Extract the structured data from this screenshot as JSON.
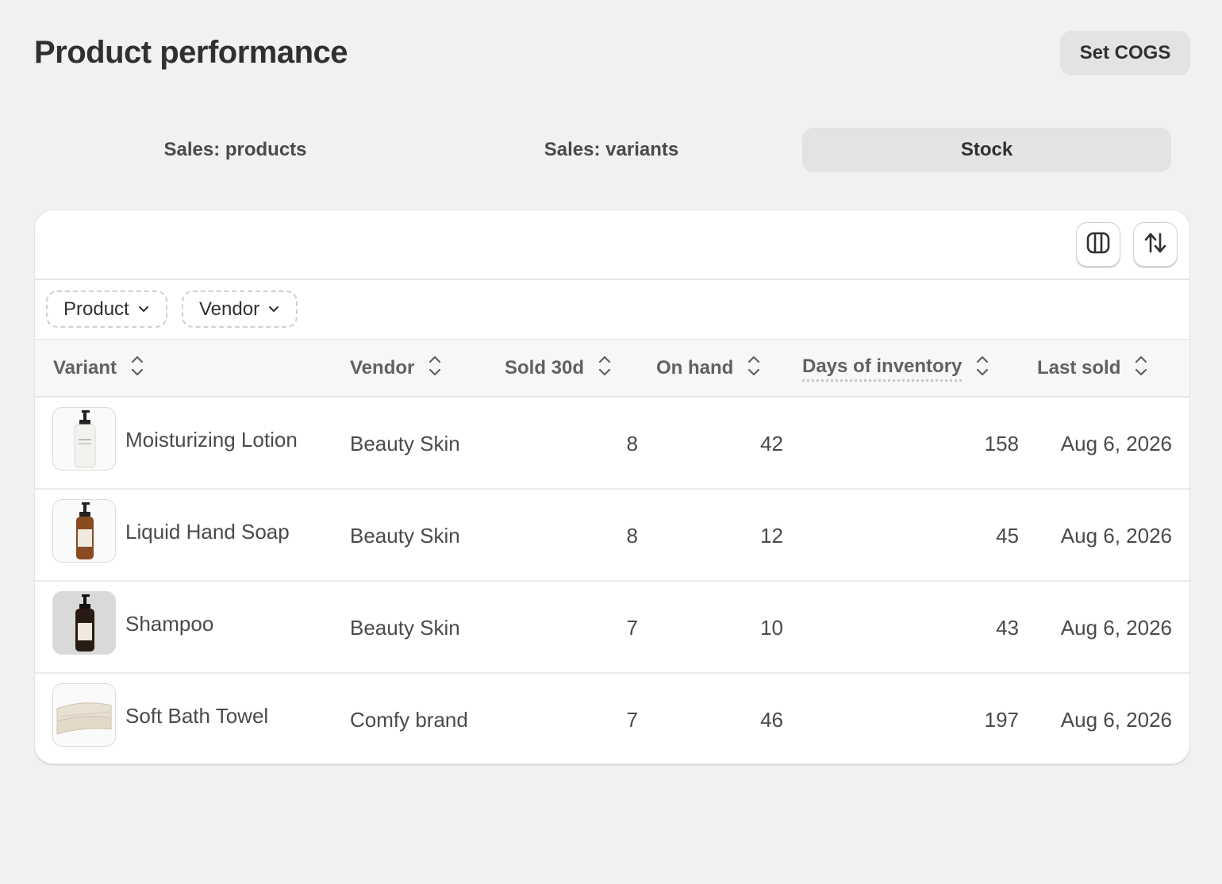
{
  "header": {
    "title": "Product performance",
    "set_cogs_label": "Set COGS"
  },
  "tabs": [
    {
      "label": "Sales: products",
      "active": false
    },
    {
      "label": "Sales: variants",
      "active": false
    },
    {
      "label": "Stock",
      "active": true
    }
  ],
  "toolbar": {
    "icons": [
      "columns-icon",
      "sort-icon"
    ]
  },
  "filters": [
    {
      "label": "Product"
    },
    {
      "label": "Vendor"
    }
  ],
  "columns": [
    "Variant",
    "Vendor",
    "Sold 30d",
    "On hand",
    "Days of inventory",
    "Last sold"
  ],
  "rows": [
    {
      "variant": "Moisturizing Lotion",
      "vendor": "Beauty Skin",
      "sold_30d": "8",
      "on_hand": "42",
      "days_of_inventory": "158",
      "last_sold": "Aug 6, 2026",
      "thumb": "lotion-bottle"
    },
    {
      "variant": "Liquid Hand Soap",
      "vendor": "Beauty Skin",
      "sold_30d": "8",
      "on_hand": "12",
      "days_of_inventory": "45",
      "last_sold": "Aug 6, 2026",
      "thumb": "soap-bottle"
    },
    {
      "variant": "Shampoo",
      "vendor": "Beauty Skin",
      "sold_30d": "7",
      "on_hand": "10",
      "days_of_inventory": "43",
      "last_sold": "Aug 6, 2026",
      "thumb": "shampoo-bottle"
    },
    {
      "variant": "Soft Bath Towel",
      "vendor": "Comfy brand",
      "sold_30d": "7",
      "on_hand": "46",
      "days_of_inventory": "197",
      "last_sold": "Aug 6, 2026",
      "thumb": "towel-stack"
    }
  ],
  "colors": {
    "background": "#f1f1f1",
    "card": "#ffffff",
    "active_tab": "#e3e3e3"
  }
}
